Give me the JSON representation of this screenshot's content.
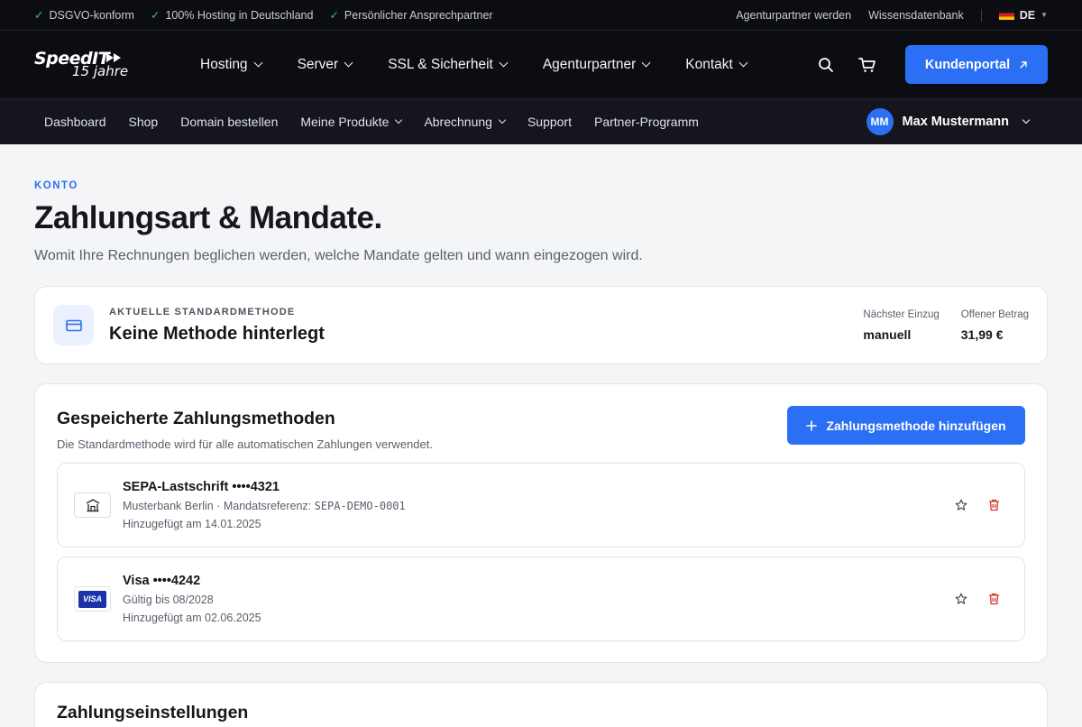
{
  "topbar": {
    "features": [
      "DSGVO-konform",
      "100% Hosting in Deutschland",
      "Persönlicher Ansprechpartner"
    ],
    "links": [
      "Agenturpartner werden",
      "Wissensdatenbank"
    ],
    "language": "DE"
  },
  "brand": {
    "name": "SpeedIT",
    "tagline": "15 jahre"
  },
  "mainnav": [
    "Hosting",
    "Server",
    "SSL & Sicherheit",
    "Agenturpartner",
    "Kontakt"
  ],
  "header": {
    "portal_label": "Kundenportal"
  },
  "subnav": {
    "items": [
      {
        "label": "Dashboard",
        "dropdown": false
      },
      {
        "label": "Shop",
        "dropdown": false
      },
      {
        "label": "Domain bestellen",
        "dropdown": false
      },
      {
        "label": "Meine Produkte",
        "dropdown": true
      },
      {
        "label": "Abrechnung",
        "dropdown": true
      },
      {
        "label": "Support",
        "dropdown": false
      },
      {
        "label": "Partner-Programm",
        "dropdown": false
      }
    ],
    "user": {
      "initials": "MM",
      "name": "Max Mustermann"
    }
  },
  "page": {
    "eyebrow": "KONTO",
    "title": "Zahlungsart & Mandate.",
    "subtitle": "Womit Ihre Rechnungen beglichen werden, welche Mandate gelten und wann eingezogen wird."
  },
  "default_method": {
    "eyebrow": "AKTUELLE STANDARDMETHODE",
    "value": "Keine Methode hinterlegt",
    "next_charge_label": "Nächster Einzug",
    "next_charge_value": "manuell",
    "open_amount_label": "Offener Betrag",
    "open_amount_value": "31,99 €"
  },
  "saved_methods": {
    "title": "Gespeicherte Zahlungsmethoden",
    "description": "Die Standardmethode wird für alle automatischen Zahlungen verwendet.",
    "add_label": "Zahlungsmethode hinzufügen",
    "items": [
      {
        "type": "bank-icon",
        "title": "SEPA-Lastschrift ••••4321",
        "line1_prefix": "Musterbank Berlin · Mandatsreferenz: ",
        "line1_mono": "SEPA-DEMO-0001",
        "line2": "Hinzugefügt am 14.01.2025"
      },
      {
        "type": "visa-logo",
        "badge": "VISA",
        "title": "Visa ••••4242",
        "line1_prefix": "Gültig bis 08/2028",
        "line1_mono": "",
        "line2": "Hinzugefügt am 02.06.2025"
      }
    ]
  },
  "settings": {
    "title": "Zahlungseinstellungen"
  },
  "colors": {
    "accent": "#2b6ff5",
    "dark": "#0c0d12",
    "danger": "#d9342b",
    "check": "#3fbf6f"
  }
}
